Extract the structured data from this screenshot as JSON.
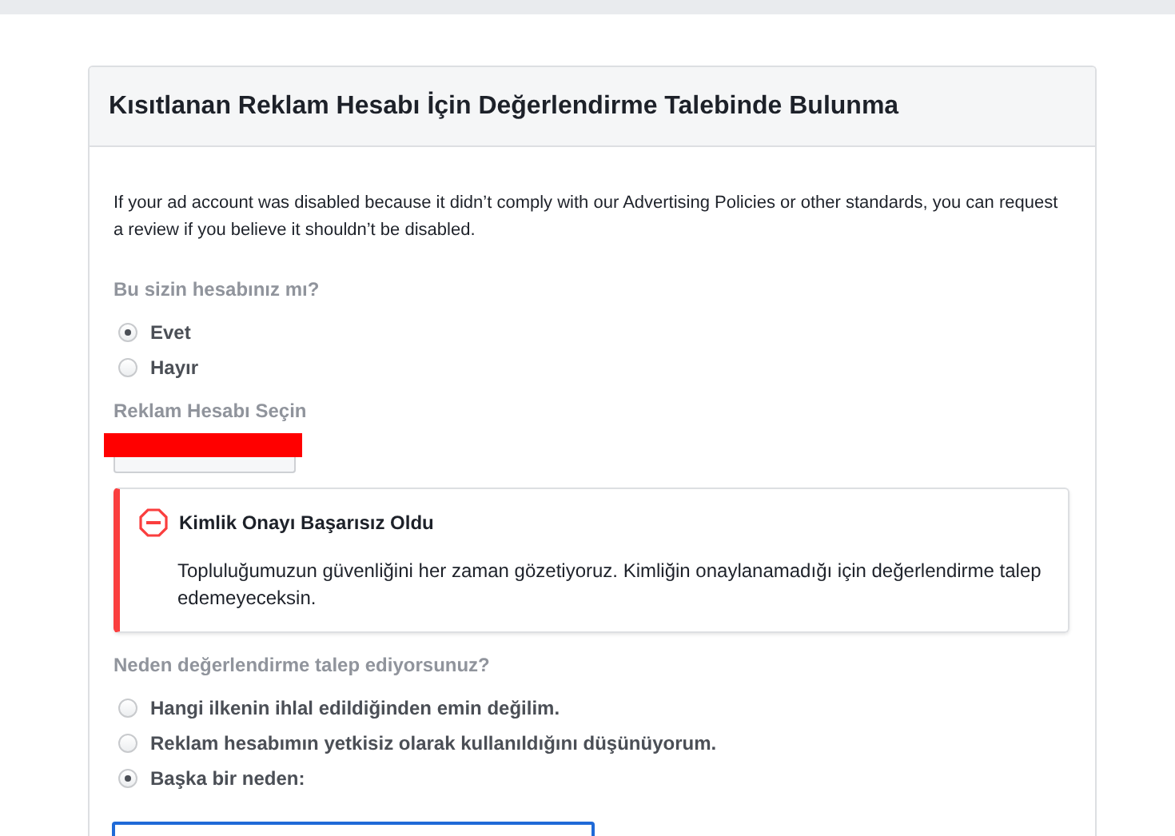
{
  "card": {
    "title": "Kısıtlanan Reklam Hesabı İçin Değerlendirme Talebinde Bulunma",
    "intro": "If your ad account was disabled because it didn’t comply with our Advertising Policies or other standards, you can request a review if you believe it shouldn’t be disabled.",
    "ownership": {
      "question": "Bu sizin hesabınız mı?",
      "options": [
        {
          "label": "Evet",
          "selected": true
        },
        {
          "label": "Hayır",
          "selected": false
        }
      ]
    },
    "account_select": {
      "label": "Reklam Hesabı Seçin",
      "redacted": true
    },
    "alert": {
      "title": "Kimlik Onayı Başarısız Oldu",
      "message": "Topluluğumuzun güvenliğini her zaman gözetiyoruz. Kimliğin onaylanamadığı için değerlendirme talep edemeyeceksin."
    },
    "reason": {
      "question": "Neden değerlendirme talep ediyorsunuz?",
      "options": [
        {
          "label": "Hangi ilkenin ihlal edildiğinden emin değilim.",
          "selected": false
        },
        {
          "label": "Reklam hesabımın yetkisiz olarak kullanıldığını düşünüyorum.",
          "selected": false
        },
        {
          "label": "Başka bir neden:",
          "selected": true
        }
      ]
    },
    "reason_text": {
      "focused": true
    }
  }
}
